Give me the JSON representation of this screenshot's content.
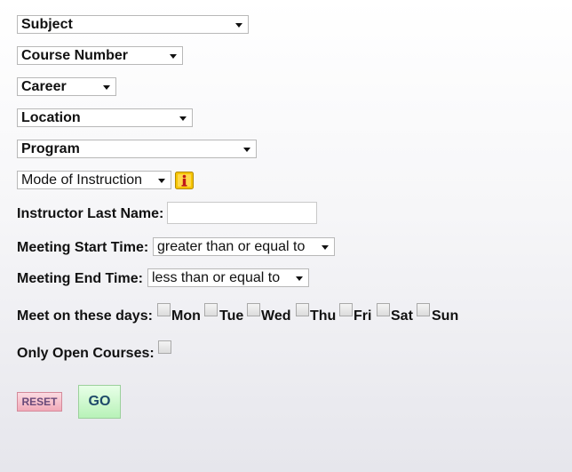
{
  "filters": {
    "subject": "Subject",
    "course_number": "Course Number",
    "career": "Career",
    "location": "Location",
    "program": "Program",
    "mode_of_instruction": "Mode of Instruction"
  },
  "instructor": {
    "label": "Instructor Last Name:",
    "value": ""
  },
  "meeting_start": {
    "label": "Meeting Start Time:",
    "selected": "greater than or equal to"
  },
  "meeting_end": {
    "label": "Meeting End Time:",
    "selected": "less than or equal to"
  },
  "days": {
    "label": "Meet on these days:",
    "items": [
      "Mon",
      "Tue",
      "Wed",
      "Thu",
      "Fri",
      "Sat",
      "Sun"
    ]
  },
  "open_courses": {
    "label": "Only Open Courses:"
  },
  "buttons": {
    "reset": "RESET",
    "go": "GO"
  },
  "icons": {
    "info": "info-icon"
  }
}
